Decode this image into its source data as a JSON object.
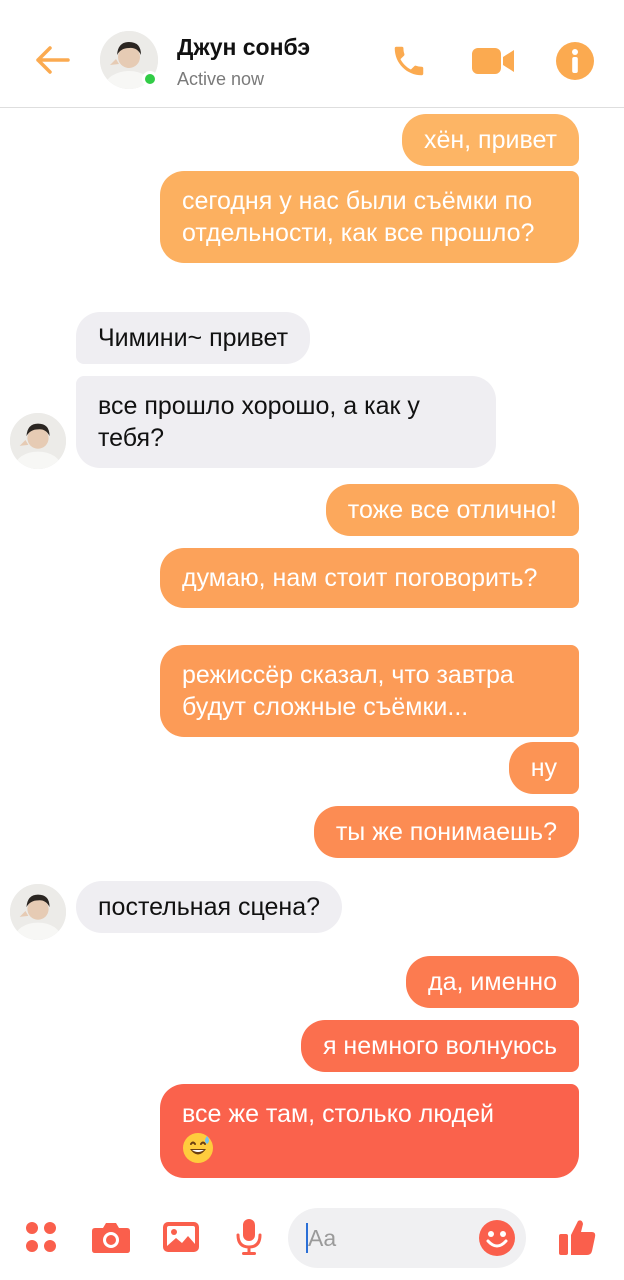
{
  "header": {
    "contact_name": "Джун сонбэ",
    "status": "Active now"
  },
  "colors": {
    "accent": "#fbaa50",
    "gradient_top": "#fdb565",
    "gradient_bottom": "#fa5c4c",
    "incoming_bg": "#efeef2",
    "online": "#31cc46"
  },
  "messages": [
    {
      "side": "out",
      "text": "хён, привет"
    },
    {
      "side": "out",
      "text": "сегодня у нас были съёмки по отдельности, как все прошло?"
    },
    {
      "side": "in",
      "text": "Чимини~ привет"
    },
    {
      "side": "in",
      "text": "все прошло хорошо, а как у тебя?"
    },
    {
      "side": "out",
      "text": "тоже все отлично!"
    },
    {
      "side": "out",
      "text": "думаю, нам стоит поговорить?"
    },
    {
      "side": "out",
      "text": "режиссёр сказал, что завтра будут сложные съёмки..."
    },
    {
      "side": "out",
      "text": "ну"
    },
    {
      "side": "out",
      "text": "ты же понимаешь?"
    },
    {
      "side": "in",
      "text": "постельная сцена?"
    },
    {
      "side": "out",
      "text": "да, именно"
    },
    {
      "side": "out",
      "text": "я немного волнуюсь"
    },
    {
      "side": "out",
      "text": "все же там, столько людей"
    }
  ],
  "composer": {
    "placeholder": "Aa"
  },
  "icons": [
    "back-arrow-icon",
    "phone-icon",
    "video-icon",
    "info-icon",
    "apps-icon",
    "camera-icon",
    "gallery-icon",
    "microphone-icon",
    "emoji-icon",
    "thumbs-up-icon"
  ]
}
